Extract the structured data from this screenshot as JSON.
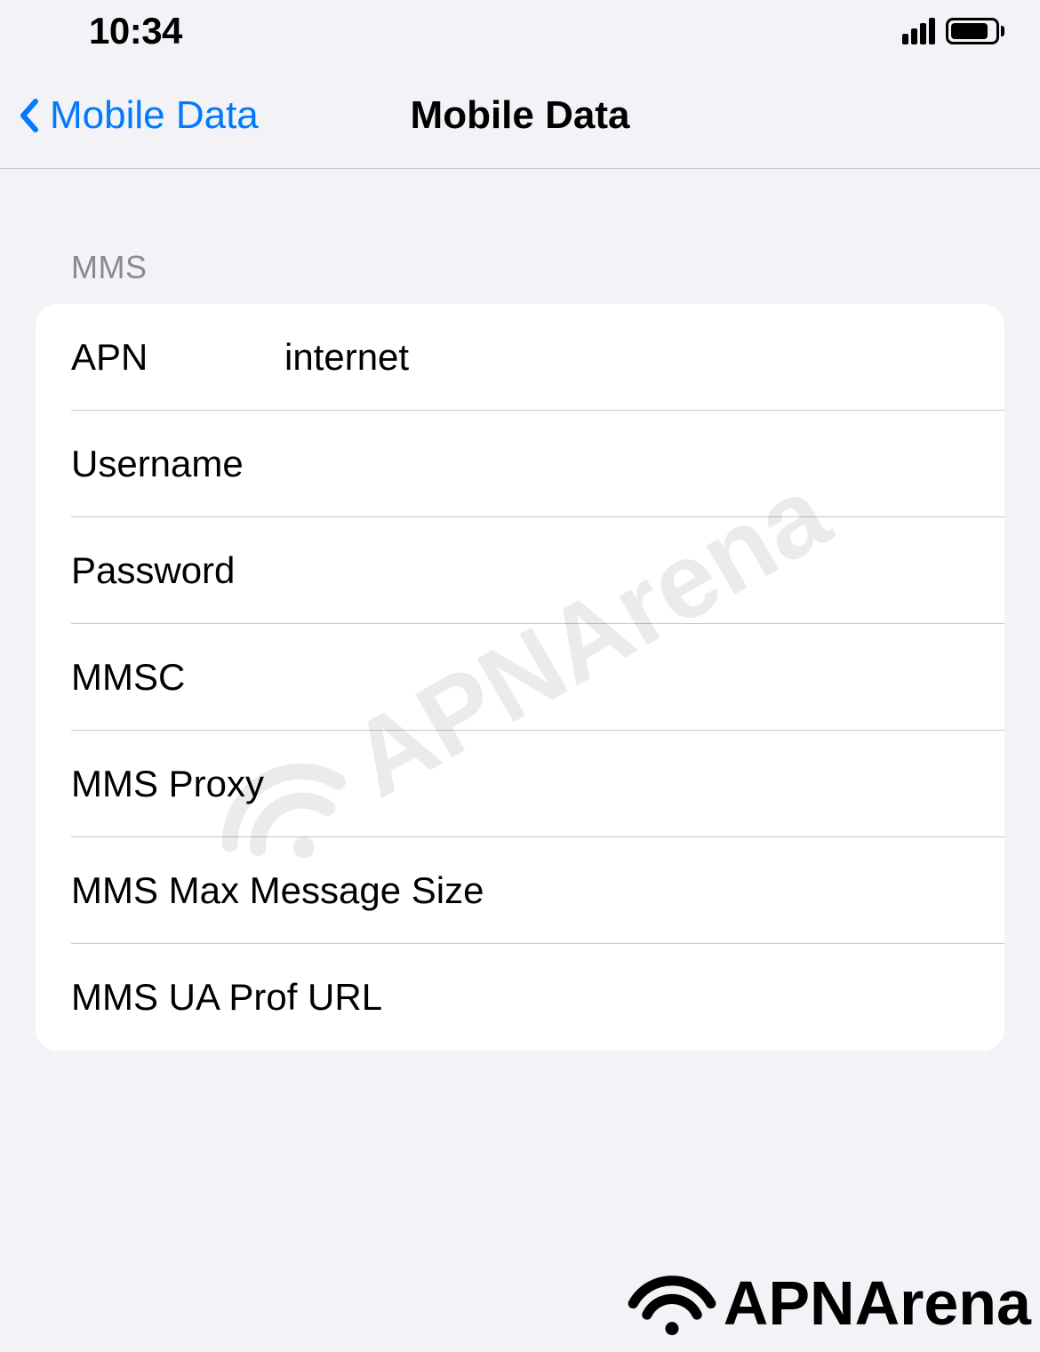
{
  "status": {
    "time": "10:34"
  },
  "nav": {
    "back_label": "Mobile Data",
    "title": "Mobile Data"
  },
  "section": {
    "header": "MMS"
  },
  "fields": {
    "apn": {
      "label": "APN",
      "value": "internet"
    },
    "username": {
      "label": "Username",
      "value": ""
    },
    "password": {
      "label": "Password",
      "value": ""
    },
    "mmsc": {
      "label": "MMSC",
      "value": ""
    },
    "mms_proxy": {
      "label": "MMS Proxy",
      "value": ""
    },
    "mms_max_size": {
      "label": "MMS Max Message Size",
      "value": ""
    },
    "mms_ua_prof": {
      "label": "MMS UA Prof URL",
      "value": ""
    }
  },
  "branding": {
    "name": "APNArena"
  }
}
